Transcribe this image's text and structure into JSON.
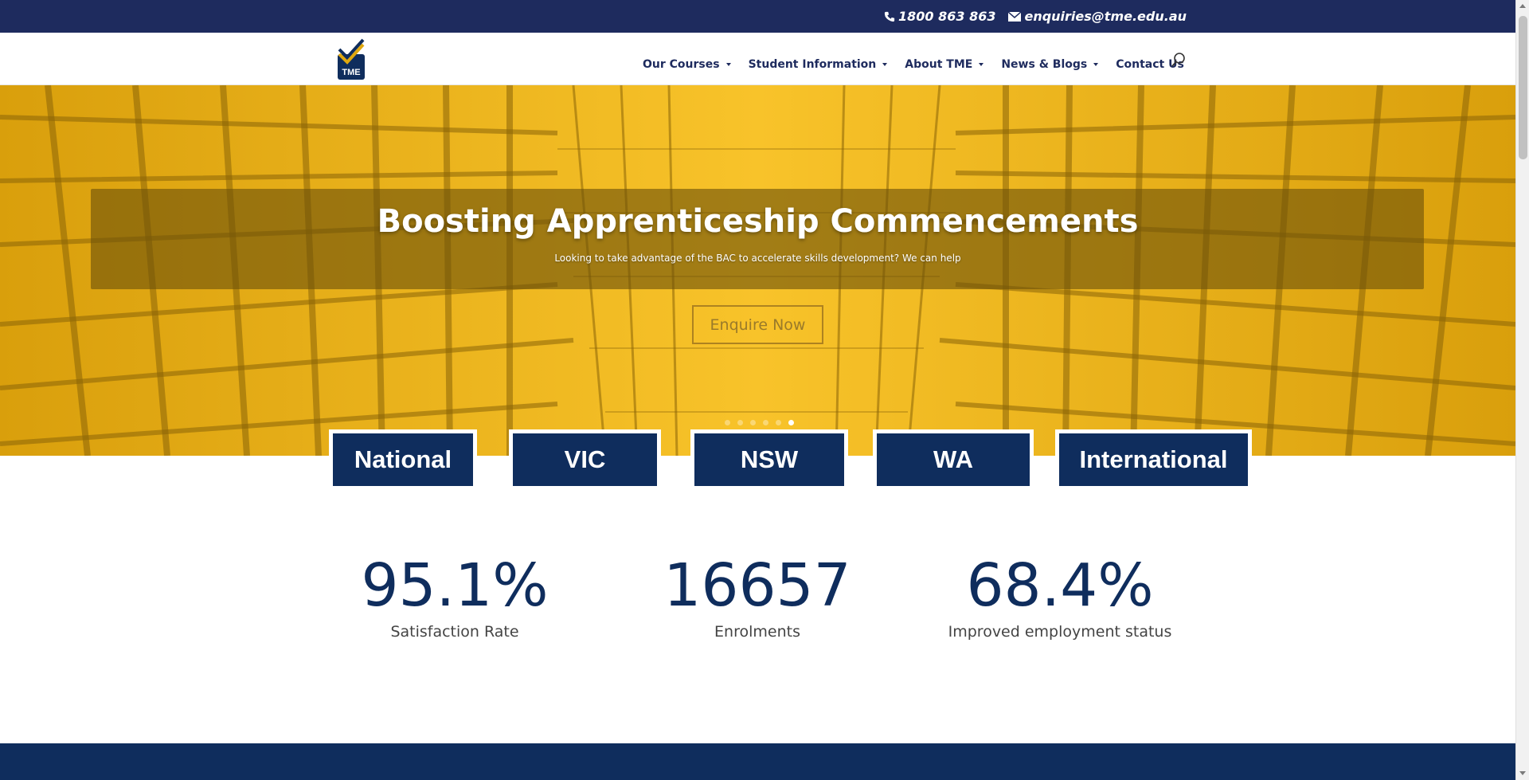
{
  "topbar": {
    "phone": "1800 863 863",
    "email": "enquiries@tme.edu.au",
    "phone_icon": "phone-icon",
    "email_icon": "envelope-icon"
  },
  "header": {
    "logo_text": "TME",
    "nav": [
      {
        "label": "Our Courses",
        "has_dropdown": true
      },
      {
        "label": "Student Information",
        "has_dropdown": true
      },
      {
        "label": "About TME",
        "has_dropdown": true
      },
      {
        "label": "News & Blogs",
        "has_dropdown": true
      },
      {
        "label": "Contact Us",
        "has_dropdown": false
      }
    ],
    "search_icon": "search-icon"
  },
  "hero": {
    "title": "Boosting Apprenticeship Commencements",
    "subtitle": "Looking to take advantage of the BAC to accelerate skills development?  We can help",
    "cta": "Enquire Now",
    "slides_count": 6,
    "active_slide": 6
  },
  "regions": [
    "National",
    "VIC",
    "NSW",
    "WA",
    "International"
  ],
  "stats": [
    {
      "value": "95.1%",
      "label": "Satisfaction Rate"
    },
    {
      "value": "16657",
      "label": "Enrolments"
    },
    {
      "value": "68.4%",
      "label": "Improved employment status"
    }
  ],
  "colors": {
    "navy": "#1e2b5e",
    "dark_blue": "#0f2d5d",
    "gold": "#e0a80e"
  }
}
